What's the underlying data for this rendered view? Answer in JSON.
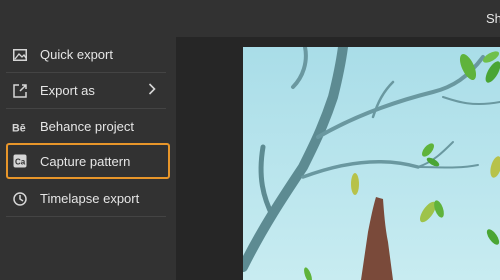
{
  "header": {
    "share_label": "Sha"
  },
  "sidebar": {
    "items": [
      {
        "label": "Quick export",
        "icon": "image-icon"
      },
      {
        "label": "Export as",
        "icon": "export-arrow-icon",
        "has_submenu": true
      },
      {
        "label": "Behance project",
        "icon": "behance-icon"
      },
      {
        "label": "Capture pattern",
        "icon": "capture-icon",
        "highlighted": true
      },
      {
        "label": "Timelapse export",
        "icon": "clock-icon"
      }
    ]
  },
  "colors": {
    "highlight": "#e8962a",
    "panel": "#323232",
    "canvas": "#262626",
    "sky": "#bfe6ee",
    "branch": "#5d8b92",
    "leaf": "#5fb33b",
    "trunk": "#7a4a3a"
  }
}
